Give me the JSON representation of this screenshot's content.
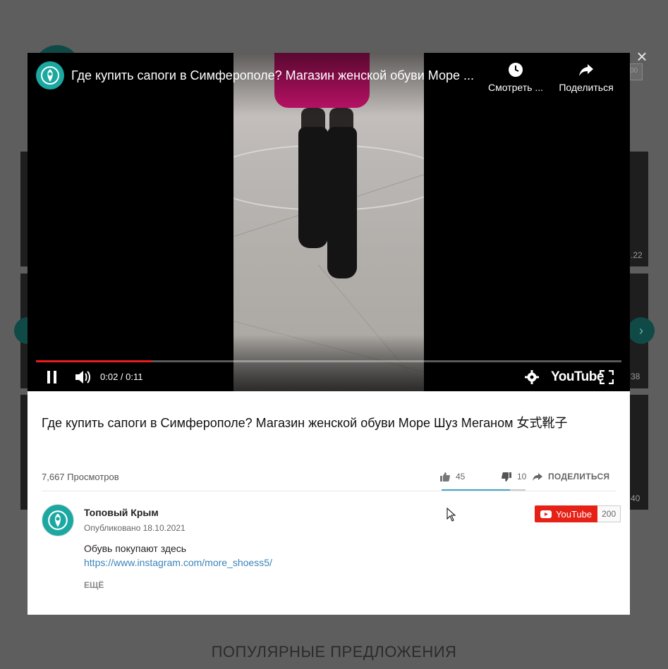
{
  "video": {
    "title": "Где купить сапоги в Симферополе? Магазин женской обуви Море ...",
    "watch_later_label": "Смотреть ...",
    "share_label": "Поделиться",
    "time": "0:02 / 0:11",
    "progress": 0.198,
    "brand": "YouTube"
  },
  "details": {
    "headline": "Где купить сапоги в Симферополе? Магазин женской обуви Море Шуз Меганом 女式靴子",
    "views": "7,667 Просмотров",
    "likes": "45",
    "dislikes": "10",
    "share": "ПОДЕЛИТЬСЯ",
    "like_ratio": 0.818
  },
  "channel": {
    "name": "Топовый Крым",
    "published": "Опубликовано 18.10.2021",
    "subscribe_label": "YouTube",
    "subscriber_count": "200"
  },
  "description": {
    "text": "Обувь покупают здесь",
    "link": "https://www.instagram.com/more_shoess5/",
    "more": "ЕЩЁ"
  },
  "background": {
    "section_title": "ПОПУЛЯРНЫЕ ПРЕДЛОЖЕНИЯ",
    "badges": [
      ".22",
      "38",
      "40"
    ],
    "header_badge": "00"
  },
  "colors": {
    "accent": "#1aa8a1",
    "progress": "#e81c1c",
    "subscribe": "#e62117",
    "link": "#3a83b8"
  }
}
